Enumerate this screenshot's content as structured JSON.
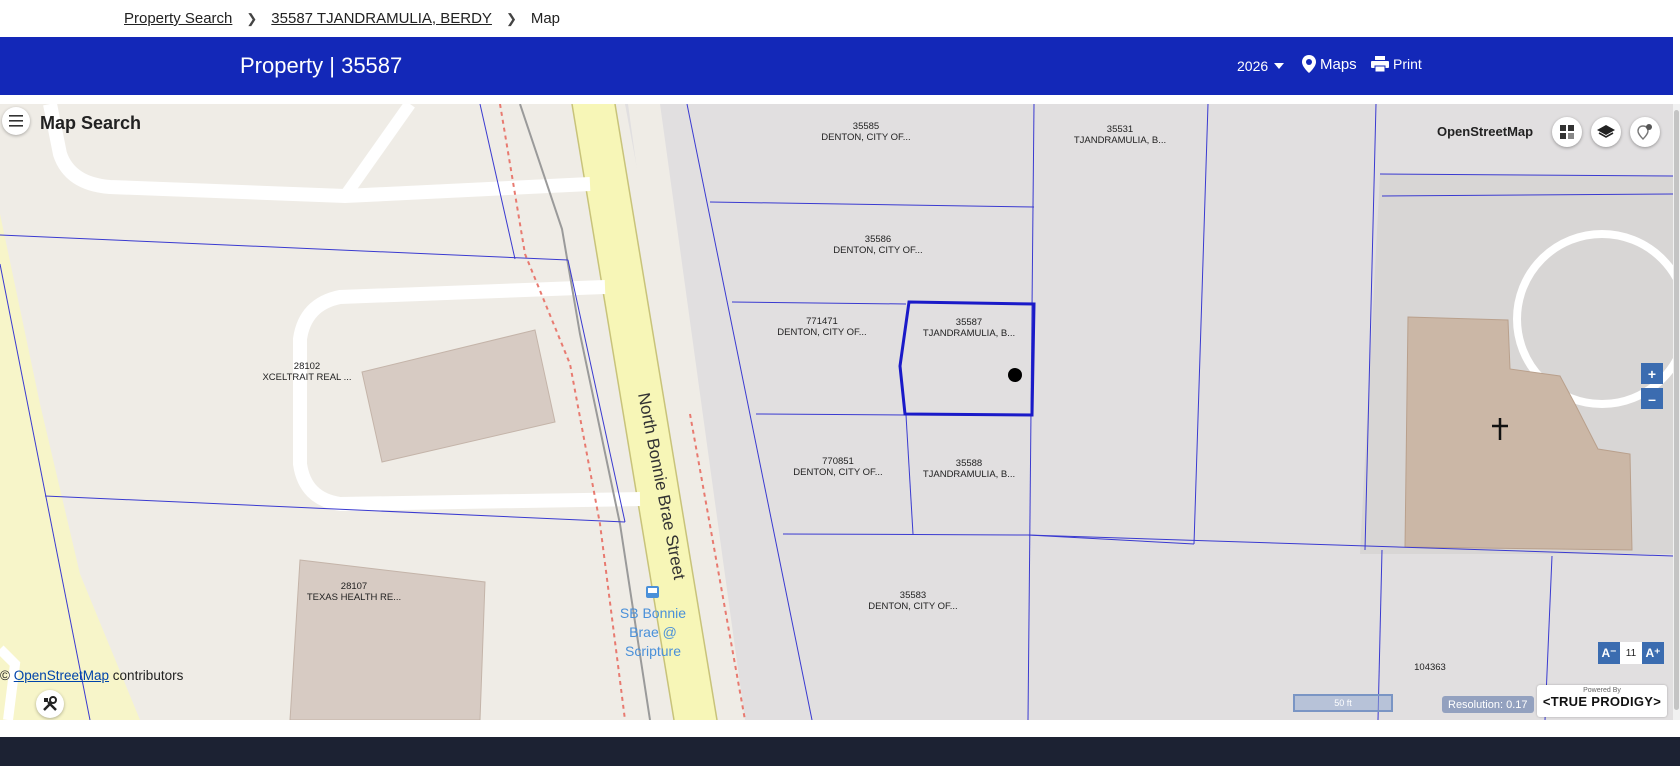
{
  "breadcrumb": {
    "items": [
      "Property Search",
      "35587 TJANDRAMULIA, BERDY",
      "Map"
    ]
  },
  "header": {
    "title": "Property | 35587",
    "year": "2026",
    "maps_label": "Maps",
    "print_label": "Print"
  },
  "map": {
    "panel_title": "Map Search",
    "basemap_label": "OpenStreetMap",
    "street_name": "North Bonnie Brae Street",
    "bus_stop": [
      "SB Bonnie",
      "Brae @",
      "Scripture"
    ],
    "parcels": [
      {
        "id": "35585",
        "owner": "DENTON, CITY OF..."
      },
      {
        "id": "35531",
        "owner": "TJANDRAMULIA, B..."
      },
      {
        "id": "35586",
        "owner": "DENTON, CITY OF..."
      },
      {
        "id": "771471",
        "owner": "DENTON, CITY OF..."
      },
      {
        "id": "35587",
        "owner": "TJANDRAMULIA, B..."
      },
      {
        "id": "28102",
        "owner": "XCELTRAIT REAL ..."
      },
      {
        "id": "770851",
        "owner": "DENTON, CITY OF..."
      },
      {
        "id": "35588",
        "owner": "TJANDRAMULIA, B..."
      },
      {
        "id": "28107",
        "owner": "TEXAS HEALTH RE..."
      },
      {
        "id": "35583",
        "owner": "DENTON, CITY OF..."
      },
      {
        "id": "104363",
        "owner": ""
      }
    ],
    "attribution_prefix": "©",
    "attribution_link": "OpenStreetMap",
    "attribution_suffix": "contributors",
    "zoom_in": "+",
    "zoom_out": "–",
    "font_decrease": "A⁻",
    "font_size": "11",
    "font_increase": "A⁺",
    "scale_label": "50 ft",
    "resolution": "Resolution: 0.17",
    "powered_by": "Powered By",
    "brand": "<TRUE PRODIGY>"
  },
  "colors": {
    "header_bg": "#1328b8",
    "parcel_line": "#3a3ad0",
    "selected_parcel": "#1a1ac8",
    "footer_bg": "#1c2233"
  }
}
